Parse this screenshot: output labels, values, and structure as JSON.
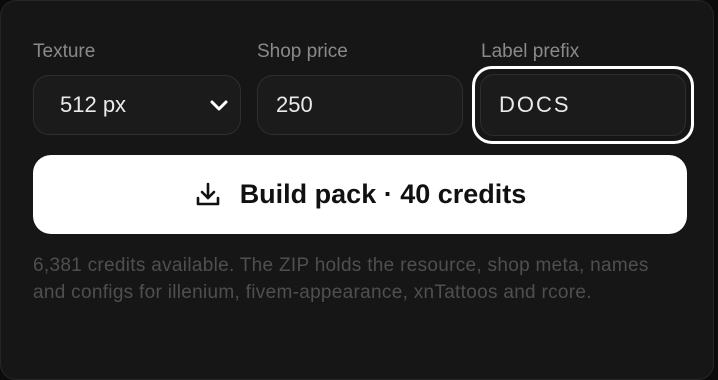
{
  "fields": {
    "texture": {
      "label": "Texture",
      "value": "512 px"
    },
    "shop_price": {
      "label": "Shop price",
      "value": "250"
    },
    "label_prefix": {
      "label": "Label prefix",
      "value": "DOCS"
    }
  },
  "build_button": {
    "label": "Build pack · 40 credits"
  },
  "info": {
    "text": "6,381 credits available. The ZIP holds the resource, shop meta, names and configs for illenium, fivem-appearance, xnTattoos and rcore."
  },
  "icons": {
    "select_chevron": "chevron-down-icon",
    "build": "download-icon"
  },
  "colors": {
    "background": "#161616",
    "accent": "#ffffff",
    "button_text": "#111111",
    "muted_text": "#4f4f4f"
  }
}
